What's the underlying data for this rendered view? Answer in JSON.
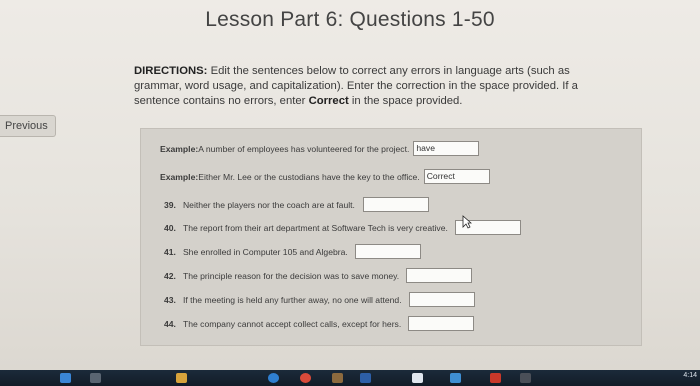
{
  "title": "Lesson Part 6: Questions 1-50",
  "directions": {
    "lead": "DIRECTIONS:",
    "text_1": " Edit the sentences below to correct any errors in language arts (such as grammar, word usage, and capitalization). Enter the correction in the space provided. If a sentence contains no errors, enter ",
    "correct_word": "Correct",
    "text_2": " in the space provided."
  },
  "nav": {
    "previous_label": "Previous"
  },
  "examples": [
    {
      "label": "Example:",
      "sentence": " A number of employees has volunteered for the project.",
      "answer": "have"
    },
    {
      "label": "Example:",
      "sentence": " Either Mr. Lee or the custodians have the key to the office.",
      "answer": "Correct"
    }
  ],
  "questions": [
    {
      "num": "39.",
      "sentence": "Neither the players nor the coach are at fault.",
      "answer": ""
    },
    {
      "num": "40.",
      "sentence": "The report from their art department at Software Tech is very creative.",
      "answer": ""
    },
    {
      "num": "41.",
      "sentence": "She enrolled in Computer 105 and Algebra.",
      "answer": ""
    },
    {
      "num": "42.",
      "sentence": "The principle reason for the decision was to save money.",
      "answer": ""
    },
    {
      "num": "43.",
      "sentence": "If the meeting is held any further away, no one will attend.",
      "answer": ""
    },
    {
      "num": "44.",
      "sentence": "The company cannot accept collect calls, except for hers.",
      "answer": ""
    }
  ],
  "taskbar": {
    "time": "4:14",
    "icons": [
      "windows-icon",
      "search-icon",
      "explorer-icon",
      "edge-icon",
      "chrome-icon",
      "app-icon",
      "word-icon",
      "store-icon",
      "mail-icon",
      "media-icon",
      "game-icon"
    ],
    "colors": {
      "bar": "#121c27",
      "accent": "#3a86d6"
    }
  }
}
